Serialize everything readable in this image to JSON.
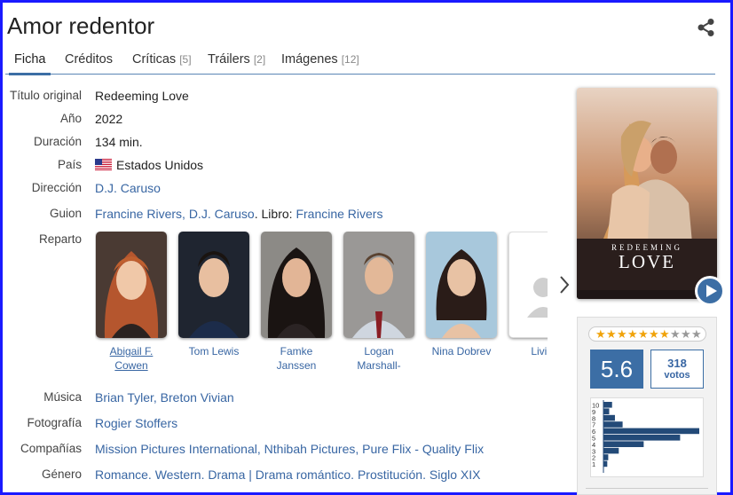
{
  "title": "Amor redentor",
  "tabs": [
    {
      "label": "Ficha",
      "count": ""
    },
    {
      "label": "Créditos",
      "count": ""
    },
    {
      "label": "Críticas",
      "count": "[5]"
    },
    {
      "label": "Tráilers",
      "count": "[2]"
    },
    {
      "label": "Imágenes",
      "count": "[12]"
    }
  ],
  "details": {
    "titulo_original": {
      "label": "Título original",
      "value": "Redeeming Love"
    },
    "anio": {
      "label": "Año",
      "value": "2022"
    },
    "duracion": {
      "label": "Duración",
      "value": "134 min."
    },
    "pais": {
      "label": "País",
      "value": "Estados Unidos"
    },
    "direccion": {
      "label": "Dirección",
      "value": "D.J. Caruso"
    },
    "guion": {
      "label": "Guion",
      "writer1": "Francine Rivers",
      "sep1": ", ",
      "writer2": "D.J. Caruso",
      "book_prefix": ". Libro: ",
      "book": "Francine Rivers"
    },
    "reparto_label": "Reparto",
    "cast": [
      {
        "name1": "Abigail F.",
        "name2": "Cowen"
      },
      {
        "name1": "Tom Lewis",
        "name2": ""
      },
      {
        "name1": "Famke",
        "name2": "Janssen"
      },
      {
        "name1": "Logan",
        "name2": "Marshall-Green"
      },
      {
        "name1": "Nina Dobrev",
        "name2": ""
      },
      {
        "name1": "Livi B",
        "name2": ""
      }
    ],
    "musica": {
      "label": "Música",
      "v1": "Brian Tyler",
      "sep": ", ",
      "v2": "Breton Vivian"
    },
    "fotografia": {
      "label": "Fotografía",
      "value": "Rogier Stoffers"
    },
    "companias": {
      "label": "Compañías",
      "v1": "Mission Pictures International",
      "sep1": ", ",
      "v2": "Nthibah Pictures",
      "sep2": ", ",
      "v3": "Pure Flix - Quality Flix"
    },
    "genero": {
      "label": "Género",
      "g1": "Romance",
      "d1": ". ",
      "g2": "Western",
      "d2": ". ",
      "g3": "Drama",
      "d3": " | ",
      "g4": "Drama romántico",
      "d4": ". ",
      "g5": "Prostitución",
      "d5": ". ",
      "g6": "Siglo XIX"
    }
  },
  "poster": {
    "title_top": "REDEEMING",
    "title_bottom": "LOVE"
  },
  "rating": {
    "score": "5.6",
    "votes_count": "318",
    "votes_label": "votos",
    "stars_filled": 7,
    "stars_total": 10
  },
  "histogram": {
    "labels": [
      "10",
      "9",
      "8",
      "7",
      "6",
      "5",
      "4",
      "3",
      "2",
      "1"
    ],
    "values": [
      0.09,
      0.06,
      0.12,
      0.2,
      1.0,
      0.8,
      0.42,
      0.16,
      0.05,
      0.04
    ]
  },
  "colors": {
    "accent": "#3c6ea5",
    "link": "#3866a3",
    "star": "#f0a30a",
    "frame": "#1a1aff"
  }
}
